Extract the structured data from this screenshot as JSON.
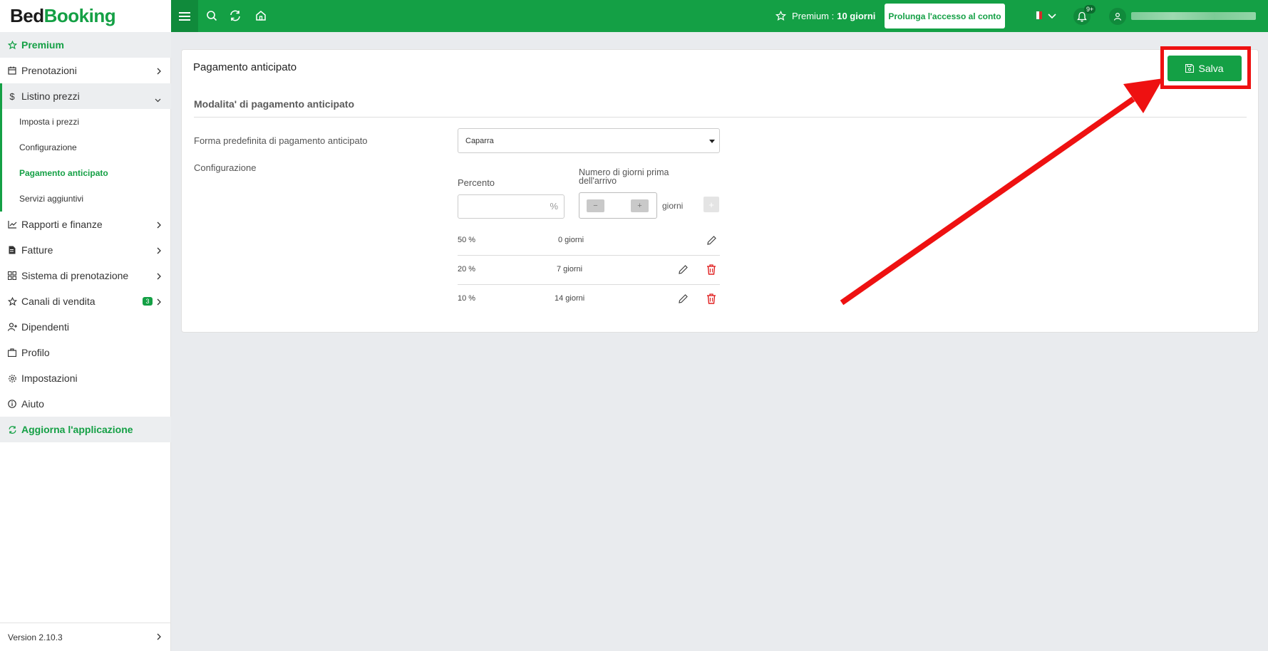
{
  "brand": {
    "part1": "Bed",
    "part2": "Booking"
  },
  "topbar": {
    "premium_label": "Premium :",
    "premium_days": "10 giorni",
    "extend_label": "Prolunga l'accesso al conto",
    "notification_count": "9+"
  },
  "sidebar": {
    "premium": "Premium",
    "prenotazioni": "Prenotazioni",
    "listino": "Listino prezzi",
    "sub": [
      "Imposta i prezzi",
      "Configurazione",
      "Pagamento anticipato",
      "Servizi aggiuntivi"
    ],
    "rapporti": "Rapporti e finanze",
    "fatture": "Fatture",
    "sistema": "Sistema di prenotazione",
    "canali": "Canali di vendita",
    "canali_badge": "3",
    "dipendenti": "Dipendenti",
    "profilo": "Profilo",
    "impostazioni": "Impostazioni",
    "aiuto": "Aiuto",
    "aggiorna": "Aggiorna l'applicazione",
    "version": "Version 2.10.3"
  },
  "card": {
    "title": "Pagamento anticipato",
    "save_label": "Salva",
    "section_title": "Modalita' di pagamento anticipato",
    "default_form_label": "Forma predefinita di pagamento anticipato",
    "default_form_value": "Caparra",
    "config_label": "Configurazione",
    "percent_label": "Percento",
    "percent_sign": "%",
    "days_label": "Numero di giorni prima dell'arrivo",
    "minus": "−",
    "plus": "+",
    "giorni": "giorni",
    "add": "+",
    "rows": [
      {
        "percent": "50 %",
        "days": "0 giorni"
      },
      {
        "percent": "20 %",
        "days": "7 giorni"
      },
      {
        "percent": "10 %",
        "days": "14 giorni"
      }
    ]
  },
  "colors": {
    "brand_green": "#14a045",
    "annotation_red": "#ee1111",
    "delete_red": "#e02020"
  }
}
